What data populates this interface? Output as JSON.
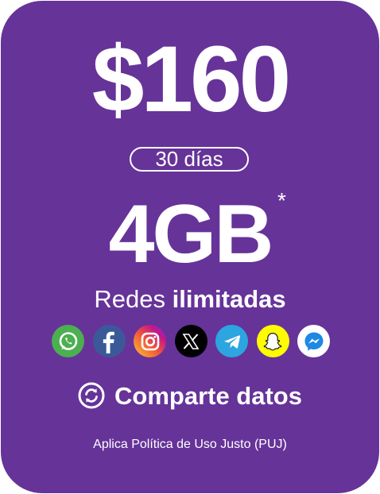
{
  "plan": {
    "price": "$160",
    "period": "30 días",
    "data_amount": "4GB",
    "data_footnote_mark": "*",
    "social_prefix": "Redes ",
    "social_emphasis": "ilimitadas",
    "share_label": "Comparte datos",
    "fup_notice": "Aplica Política de Uso Justo (PUJ)"
  },
  "apps": [
    {
      "name": "whatsapp-icon",
      "color": "#4caf50"
    },
    {
      "name": "facebook-icon",
      "color": "#3b5998"
    },
    {
      "name": "instagram-icon",
      "color": "#e1306c"
    },
    {
      "name": "x-icon",
      "color": "#000000"
    },
    {
      "name": "telegram-icon",
      "color": "#2ca5e0"
    },
    {
      "name": "snapchat-icon",
      "color": "#fffc00"
    },
    {
      "name": "messenger-icon",
      "color": "#1e88e5"
    }
  ],
  "colors": {
    "card_background": "#663399",
    "text": "#ffffff"
  }
}
